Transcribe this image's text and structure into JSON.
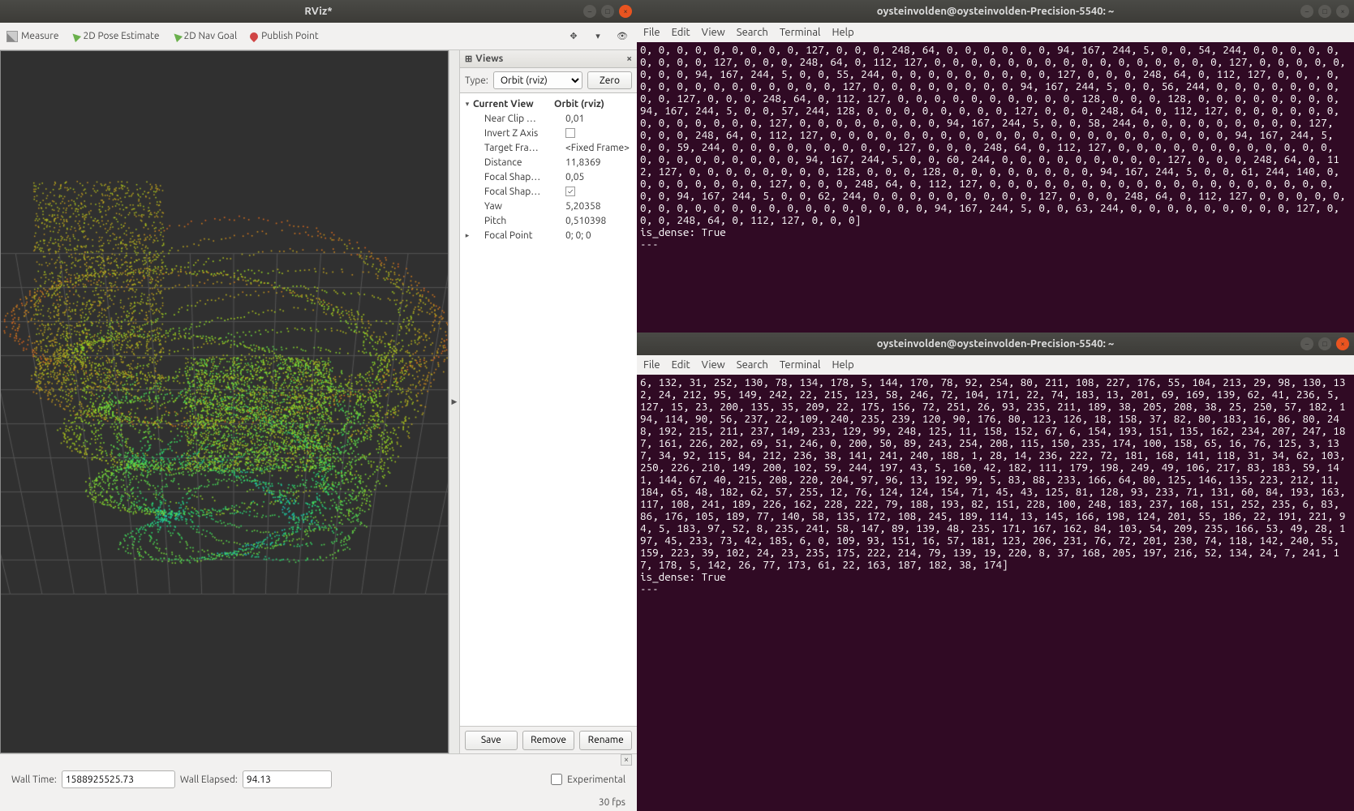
{
  "rviz": {
    "title": "RViz*",
    "toolbar": {
      "measure": "Measure",
      "pose_estimate": "2D Pose Estimate",
      "nav_goal": "2D Nav Goal",
      "publish_point": "Publish Point"
    },
    "views_panel": {
      "header": "Views",
      "type_label": "Type:",
      "type_value": "Orbit (rviz)",
      "zero": "Zero",
      "current_view_label": "Current View",
      "current_view_value": "Orbit (rviz)",
      "rows": [
        {
          "label": "Near Clip …",
          "value": "0,01"
        },
        {
          "label": "Invert Z Axis",
          "value_checkbox": false
        },
        {
          "label": "Target Fra…",
          "value": "<Fixed Frame>"
        },
        {
          "label": "Distance",
          "value": "11,8369"
        },
        {
          "label": "Focal Shap…",
          "value": "0,05"
        },
        {
          "label": "Focal Shap…",
          "value_checkbox": true
        },
        {
          "label": "Yaw",
          "value": "5,20358"
        },
        {
          "label": "Pitch",
          "value": "0,510398"
        },
        {
          "label": "Focal Point",
          "value": "0; 0; 0",
          "expandable": true
        }
      ],
      "buttons": {
        "save": "Save",
        "remove": "Remove",
        "rename": "Rename"
      }
    },
    "status": {
      "wall_time_label": "Wall Time:",
      "wall_time_value": "1588925525.73",
      "wall_elapsed_label": "Wall Elapsed:",
      "wall_elapsed_value": "94.13",
      "experimental_label": "Experimental",
      "fps": "30 fps"
    }
  },
  "terminal_common": {
    "title": "oysteinvolden@oysteinvolden-Precision-5540: ~",
    "menu": {
      "file": "File",
      "edit": "Edit",
      "view": "View",
      "search": "Search",
      "terminal": "Terminal",
      "help": "Help"
    }
  },
  "terminal1": {
    "body": "0, 0, 0, 0, 0, 0, 0, 0, 0, 127, 0, 0, 0, 248, 64, 0, 0, 0, 0, 0, 0, 94, 167, 244, 5, 0, 0, 54, 244, 0, 0, 0, 0, 0, 0, 0, 0, 0, 127, 0, 0, 0, 248, 64, 0, 112, 127, 0, 0, 0, 0, 0, 0, 0, 0, 0, 0, 0, 0, 0, 0, 0, 0, 127, 0, 0, 0, 0, 0, 0, 0, 0, 94, 167, 244, 5, 0, 0, 55, 244, 0, 0, 0, 0, 0, 0, 0, 0, 0, 127, 0, 0, 0, 248, 64, 0, 112, 127, 0, 0, , 0, 0, 0, 0, 0, 0, 0, 0, 0, 0, 0, 0, 127, 0, 0, 0, 0, 0, 0, 0, 0, 94, 167, 244, 5, 0, 0, 56, 244, 0, 0, 0, 0, 0, 0, 0, 0, 0, 127, 0, 0, 0, 248, 64, 0, 112, 127, 0, 0, 0, 0, 0, 0, 0, 0, 0, 0, 128, 0, 0, 0, 128, 0, 0, 0, 0, 0, 0, 0, 0, 94, 167, 244, 5, 0, 0, 57, 244, 128, 0, 0, 0, 0, 0, 0, 0, 0, 127, 0, 0, 0, 248, 64, 0, 112, 127, 0, 0, 0, 0, 0, 0, 0, 0, 0, 0, 0, 0, 0, 127, 0, 0, 0, 0, 0, 0, 0, 0, 94, 167, 244, 5, 0, 0, 58, 244, 0, 0, 0, 0, 0, 0, 0, 0, 0, 127, 0, 0, 0, 248, 64, 0, 112, 127, 0, 0, 0, 0, 0, 0, 0, 0, 0, 0, 0, 0, 0, 0, 0, 0, 0, 0, 0, 0, 0, 0, 94, 167, 244, 5, 0, 0, 59, 244, 0, 0, 0, 0, 0, 0, 0, 0, 0, 127, 0, 0, 0, 248, 64, 0, 112, 127, 0, 0, 0, 0, 0, 0, 0, 0, 0, 0, 0, 0, 0, 0, 0, 0, 0, 0, 0, 0, 0, 94, 167, 244, 5, 0, 0, 60, 244, 0, 0, 0, 0, 0, 0, 0, 0, 0, 127, 0, 0, 0, 248, 64, 0, 112, 127, 0, 0, 0, 0, 0, 0, 0, 0, 128, 0, 0, 0, 128, 0, 0, 0, 0, 0, 0, 0, 0, 94, 167, 244, 5, 0, 0, 61, 244, 140, 0, 0, 0, 0, 0, 0, 0, 0, 127, 0, 0, 0, 248, 64, 0, 112, 127, 0, 0, 0, 0, 0, 0, 0, 0, 0, 0, 0, 0, 0, 0, 0, 0, 0, 0, 0, 0, 0, 94, 167, 244, 5, 0, 0, 62, 244, 0, 0, 0, 0, 0, 0, 0, 0, 0, 127, 0, 0, 0, 248, 64, 0, 112, 127, 0, 0, 0, 0, 0, 0, 0, 0, 0, 0, 0, 0, 0, 0, 0, 0, 0, 0, 0, 0, 0, 94, 167, 244, 5, 0, 0, 63, 244, 0, 0, 0, 0, 0, 0, 0, 0, 0, 127, 0, 0, 0, 248, 64, 0, 112, 127, 0, 0, 0]\nis_dense: True\n---\n"
  },
  "terminal2": {
    "body": "6, 132, 31, 252, 130, 78, 134, 178, 5, 144, 170, 78, 92, 254, 80, 211, 108, 227, 176, 55, 104, 213, 29, 98, 130, 132, 24, 212, 95, 149, 242, 22, 215, 123, 58, 246, 72, 104, 171, 22, 74, 183, 13, 201, 69, 169, 139, 62, 41, 236, 5, 127, 15, 23, 200, 135, 35, 209, 22, 175, 156, 72, 251, 26, 93, 235, 211, 189, 38, 205, 208, 38, 25, 250, 57, 182, 194, 114, 90, 56, 237, 22, 109, 240, 235, 239, 120, 90, 176, 80, 123, 126, 18, 158, 37, 82, 80, 183, 16, 86, 80, 248, 192, 215, 211, 237, 149, 233, 129, 99, 248, 125, 11, 158, 152, 67, 6, 154, 193, 151, 135, 162, 234, 207, 247, 187, 161, 226, 202, 69, 51, 246, 0, 200, 50, 89, 243, 254, 208, 115, 150, 235, 174, 100, 158, 65, 16, 76, 125, 3, 137, 34, 92, 115, 84, 212, 236, 38, 141, 241, 240, 188, 1, 28, 14, 236, 222, 72, 181, 168, 141, 118, 31, 34, 62, 103, 250, 226, 210, 149, 200, 102, 59, 244, 197, 43, 5, 160, 42, 182, 111, 179, 198, 249, 49, 106, 217, 83, 183, 59, 141, 144, 67, 40, 215, 208, 220, 204, 97, 96, 13, 192, 99, 5, 83, 88, 233, 166, 64, 80, 125, 146, 135, 223, 212, 11, 184, 65, 48, 182, 62, 57, 255, 12, 76, 124, 124, 154, 71, 45, 43, 125, 81, 128, 93, 233, 71, 131, 60, 84, 193, 163, 117, 108, 241, 189, 226, 162, 228, 222, 79, 188, 193, 82, 151, 228, 100, 248, 183, 237, 168, 151, 252, 235, 6, 83, 86, 176, 105, 189, 77, 140, 58, 135, 172, 108, 245, 189, 114, 13, 145, 166, 198, 124, 201, 55, 186, 22, 191, 221, 94, 5, 183, 97, 52, 8, 235, 241, 58, 147, 89, 139, 48, 235, 171, 167, 162, 84, 103, 54, 209, 235, 166, 53, 49, 28, 197, 45, 233, 73, 42, 185, 6, 0, 109, 93, 151, 16, 57, 181, 123, 206, 231, 76, 72, 201, 230, 74, 118, 142, 240, 55, 159, 223, 39, 102, 24, 23, 235, 175, 222, 214, 79, 139, 19, 220, 8, 37, 168, 205, 197, 216, 52, 134, 24, 7, 241, 17, 178, 5, 142, 26, 77, 173, 61, 22, 163, 187, 182, 38, 174]\nis_dense: True\n---\n"
  }
}
